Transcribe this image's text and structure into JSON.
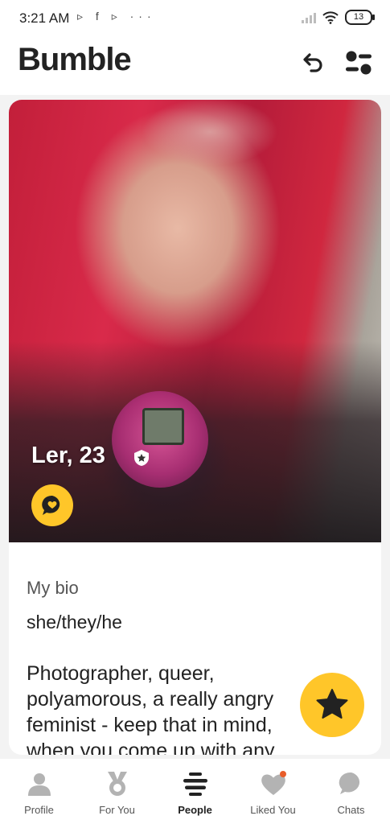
{
  "status_bar": {
    "time": "3:21 AM",
    "left_icons": "▹ f ▹ ···",
    "battery": "13"
  },
  "header": {
    "logo": "Bumble",
    "undo_icon": "undo-icon",
    "filter_icon": "filter-sliders-icon"
  },
  "profile": {
    "name_age": "Ler, 23",
    "verified_icon": "shield-star-icon",
    "compliment_icon": "chat-heart-icon"
  },
  "bio": {
    "heading": "My bio",
    "pronouns": "she/they/he",
    "text": "Photographer, queer, polyamorous, a really angry feminist - keep that in mind, when you come up with any"
  },
  "superswipe_icon": "star-icon",
  "nav": {
    "items": [
      {
        "label": "Profile",
        "icon": "person-icon"
      },
      {
        "label": "For You",
        "icon": "medal-icon"
      },
      {
        "label": "People",
        "icon": "stack-icon"
      },
      {
        "label": "Liked You",
        "icon": "heart-icon"
      },
      {
        "label": "Chats",
        "icon": "chat-bubble-icon"
      }
    ],
    "active": "People"
  },
  "colors": {
    "accent": "#ffc629",
    "text": "#222222",
    "notification_dot": "#e85d2a"
  }
}
